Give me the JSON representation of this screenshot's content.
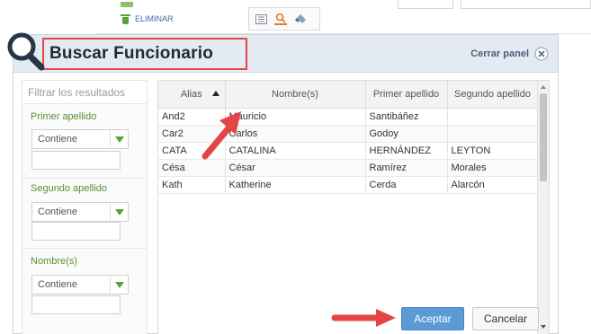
{
  "toolbar": {
    "eliminar_label": "ELIMINAR",
    "icons": [
      "list-icon",
      "search-icon",
      "eraser-icon"
    ]
  },
  "panel": {
    "title": "Buscar Funcionario",
    "close_label": "Cerrar panel"
  },
  "filters": {
    "search_placeholder": "Filtrar los resultados",
    "groups": [
      {
        "label": "Primer apellido",
        "operator": "Contiene",
        "value": ""
      },
      {
        "label": "Segundo apellido",
        "operator": "Contiene",
        "value": ""
      },
      {
        "label": "Nombre(s)",
        "operator": "Contiene",
        "value": ""
      }
    ]
  },
  "grid": {
    "columns": [
      "Alias",
      "Nombre(s)",
      "Primer apellido",
      "Segundo apellido"
    ],
    "rows": [
      [
        "And2",
        "Mauricio",
        "Santibáñez",
        ""
      ],
      [
        "Car2",
        "Carlos",
        "Godoy",
        ""
      ],
      [
        "CATA",
        "CATALINA",
        "HERNÁNDEZ",
        "LEYTON"
      ],
      [
        "Césa",
        "César",
        "Ramírez",
        "Morales"
      ],
      [
        "Kath",
        "Katherine",
        "Cerda",
        "Alarcón"
      ]
    ]
  },
  "buttons": {
    "accept": "Aceptar",
    "cancel": "Cancelar"
  },
  "colors": {
    "accent_green": "#5aa13a",
    "highlight_red": "#e04848",
    "accept_blue": "#5a9ad5",
    "header_bg": "#e4eaf1"
  }
}
